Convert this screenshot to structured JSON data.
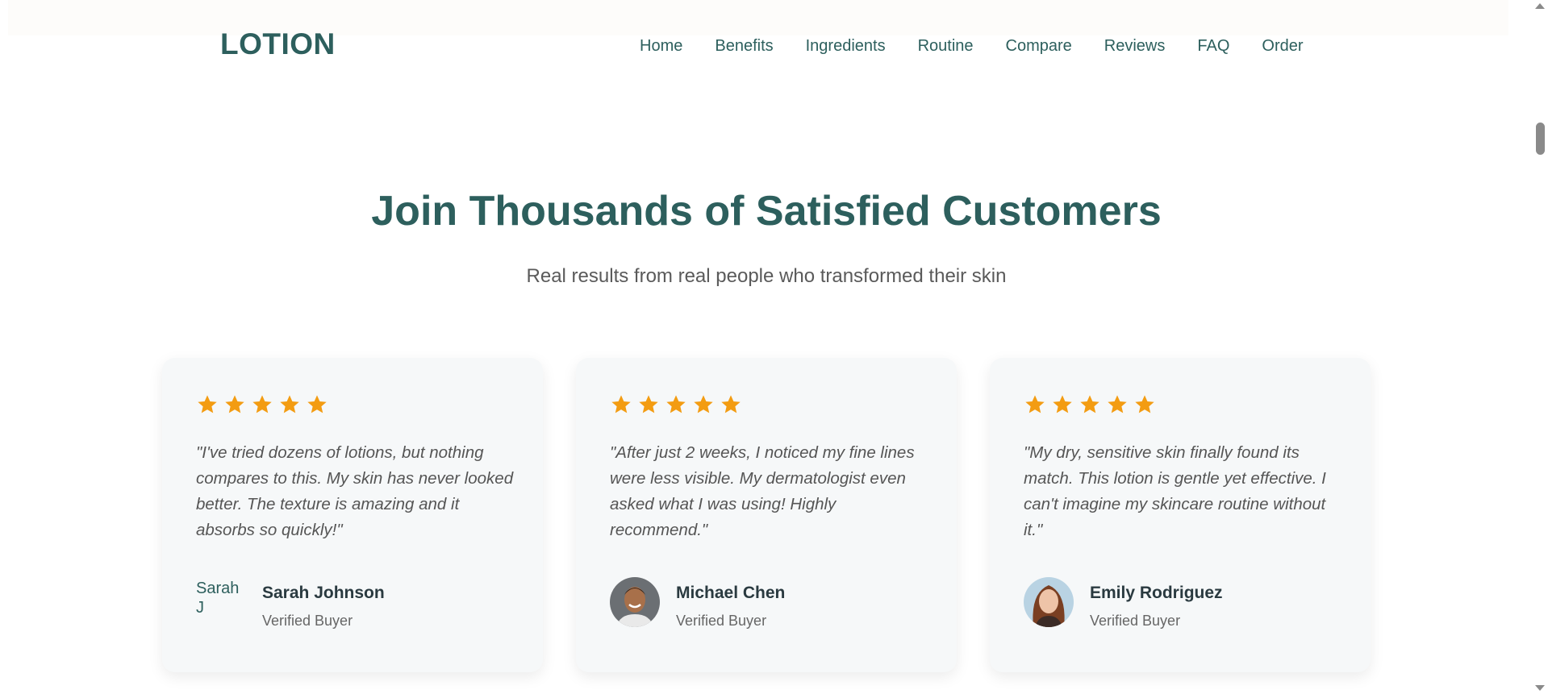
{
  "header": {
    "logo": "LOTION",
    "nav": [
      "Home",
      "Benefits",
      "Ingredients",
      "Routine",
      "Compare",
      "Reviews",
      "FAQ",
      "Order"
    ]
  },
  "section": {
    "title": "Join Thousands of Satisfied Customers",
    "subtitle": "Real results from real people who transformed their skin"
  },
  "testimonials": [
    {
      "rating": 5,
      "quote": "\"I've tried dozens of lotions, but nothing compares to this. My skin has never looked better. The texture is amazing and it absorbs so quickly!\"",
      "name": "Sarah Johnson",
      "role": "Verified Buyer",
      "avatar_alt": "Sarah J"
    },
    {
      "rating": 5,
      "quote": "\"After just 2 weeks, I noticed my fine lines were less visible. My dermatologist even asked what I was using! Highly recommend.\"",
      "name": "Michael Chen",
      "role": "Verified Buyer",
      "avatar_alt": "Michael Chen"
    },
    {
      "rating": 5,
      "quote": "\"My dry, sensitive skin finally found its match. This lotion is gentle yet effective. I can't imagine my skincare routine without it.\"",
      "name": "Emily Rodriguez",
      "role": "Verified Buyer",
      "avatar_alt": "Emily Rodriguez"
    }
  ],
  "colors": {
    "brand": "#2d5f5d",
    "star": "#f39c12",
    "card_bg": "#f6f8f9"
  }
}
